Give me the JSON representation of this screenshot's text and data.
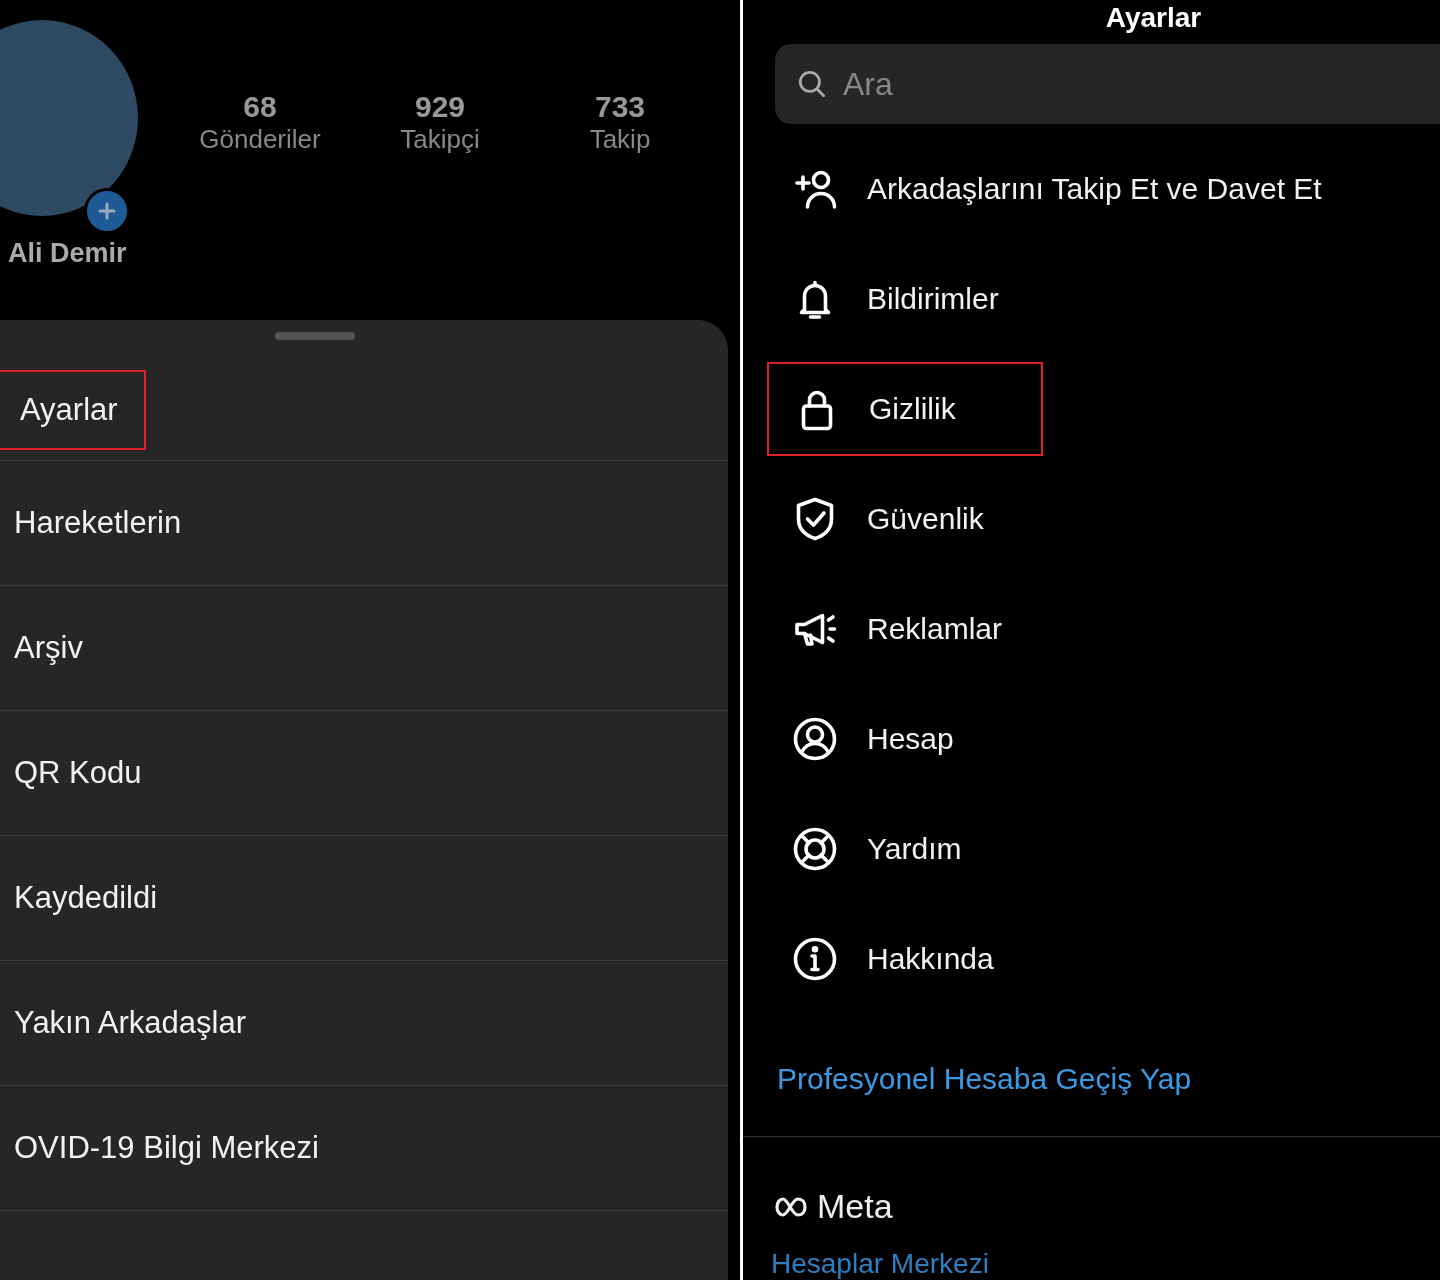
{
  "profile": {
    "name": "Ali Demir",
    "stats": [
      {
        "value": "68",
        "label": "Gönderiler"
      },
      {
        "value": "929",
        "label": "Takipçi"
      },
      {
        "value": "733",
        "label": "Takip"
      }
    ]
  },
  "menu_sheet": {
    "items": [
      {
        "label": "Ayarlar",
        "highlighted": true
      },
      {
        "label": "Hareketlerin",
        "highlighted": false
      },
      {
        "label": "Arşiv",
        "highlighted": false
      },
      {
        "label": "QR Kodu",
        "highlighted": false
      },
      {
        "label": "Kaydedildi",
        "highlighted": false
      },
      {
        "label": "Yakın Arkadaşlar",
        "highlighted": false
      },
      {
        "label": "OVID-19 Bilgi Merkezi",
        "highlighted": false
      }
    ]
  },
  "settings": {
    "title": "Ayarlar",
    "search": {
      "placeholder": "Ara"
    },
    "items": [
      {
        "kind": "add-person",
        "label": "Arkadaşlarını Takip Et ve Davet Et",
        "highlighted": false
      },
      {
        "kind": "bell",
        "label": "Bildirimler",
        "highlighted": false
      },
      {
        "kind": "lock",
        "label": "Gizlilik",
        "highlighted": true
      },
      {
        "kind": "shield",
        "label": "Güvenlik",
        "highlighted": false
      },
      {
        "kind": "megaphone",
        "label": "Reklamlar",
        "highlighted": false
      },
      {
        "kind": "person-circle",
        "label": "Hesap",
        "highlighted": false
      },
      {
        "kind": "lifebuoy",
        "label": "Yardım",
        "highlighted": false
      },
      {
        "kind": "info",
        "label": "Hakkında",
        "highlighted": false
      }
    ],
    "pro_link": "Profesyonel Hesaba Geçiş Yap",
    "meta_logo": "Meta",
    "accounts_link": "Hesaplar Merkezi"
  }
}
